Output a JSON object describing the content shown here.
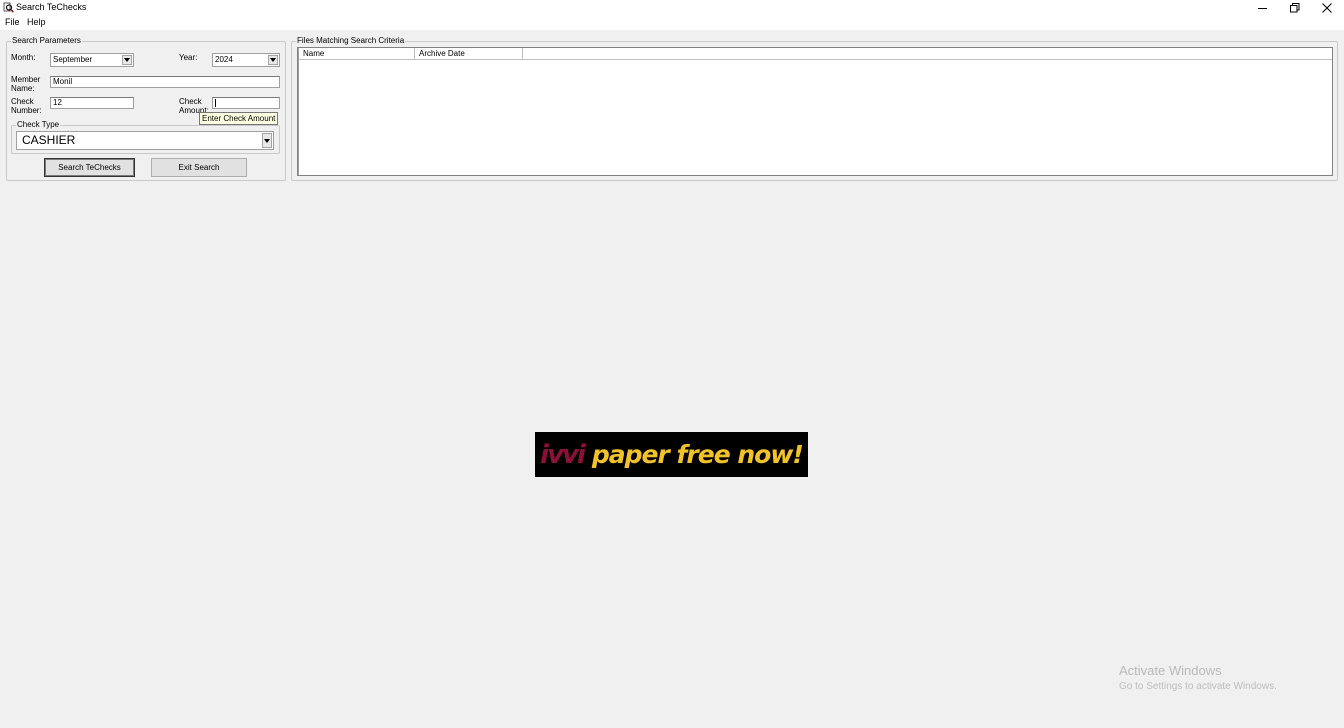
{
  "window": {
    "title": "Search TeChecks",
    "icon": "search-magnifier-icon",
    "controls": [
      "minimize-icon",
      "restore-icon",
      "close-icon"
    ]
  },
  "menu": {
    "file": "File",
    "help": "Help"
  },
  "search_parameters": {
    "legend": "Search Parameters",
    "month_label": "Month:",
    "month_value": "September",
    "year_label": "Year:",
    "year_value": "2024",
    "member_name_label_line1": "Member",
    "member_name_label_line2": "Name:",
    "member_name_value": "Monil",
    "check_number_label_line1": "Check",
    "check_number_label_line2": "Number:",
    "check_number_value": "12",
    "check_amount_label_line1": "Check",
    "check_amount_label_line2": "Amount:",
    "check_amount_value": "",
    "check_amount_tooltip": "Enter Check Amount",
    "check_type_legend": "Check Type",
    "check_type_value": "CASHIER",
    "search_button_label": "Search TeChecks",
    "exit_button_label": "Exit Search"
  },
  "results": {
    "legend": "Files Matching Search Criteria",
    "columns": [
      "Name",
      "Archive Date"
    ],
    "rows": []
  },
  "banner": {
    "logo": "ivvi",
    "tagline": "paper free now!",
    "logo_color": "#8a1236",
    "tagline_color": "#f2c22b"
  },
  "watermark": {
    "title": "Activate Windows",
    "subtitle": "Go to Settings to activate Windows."
  }
}
